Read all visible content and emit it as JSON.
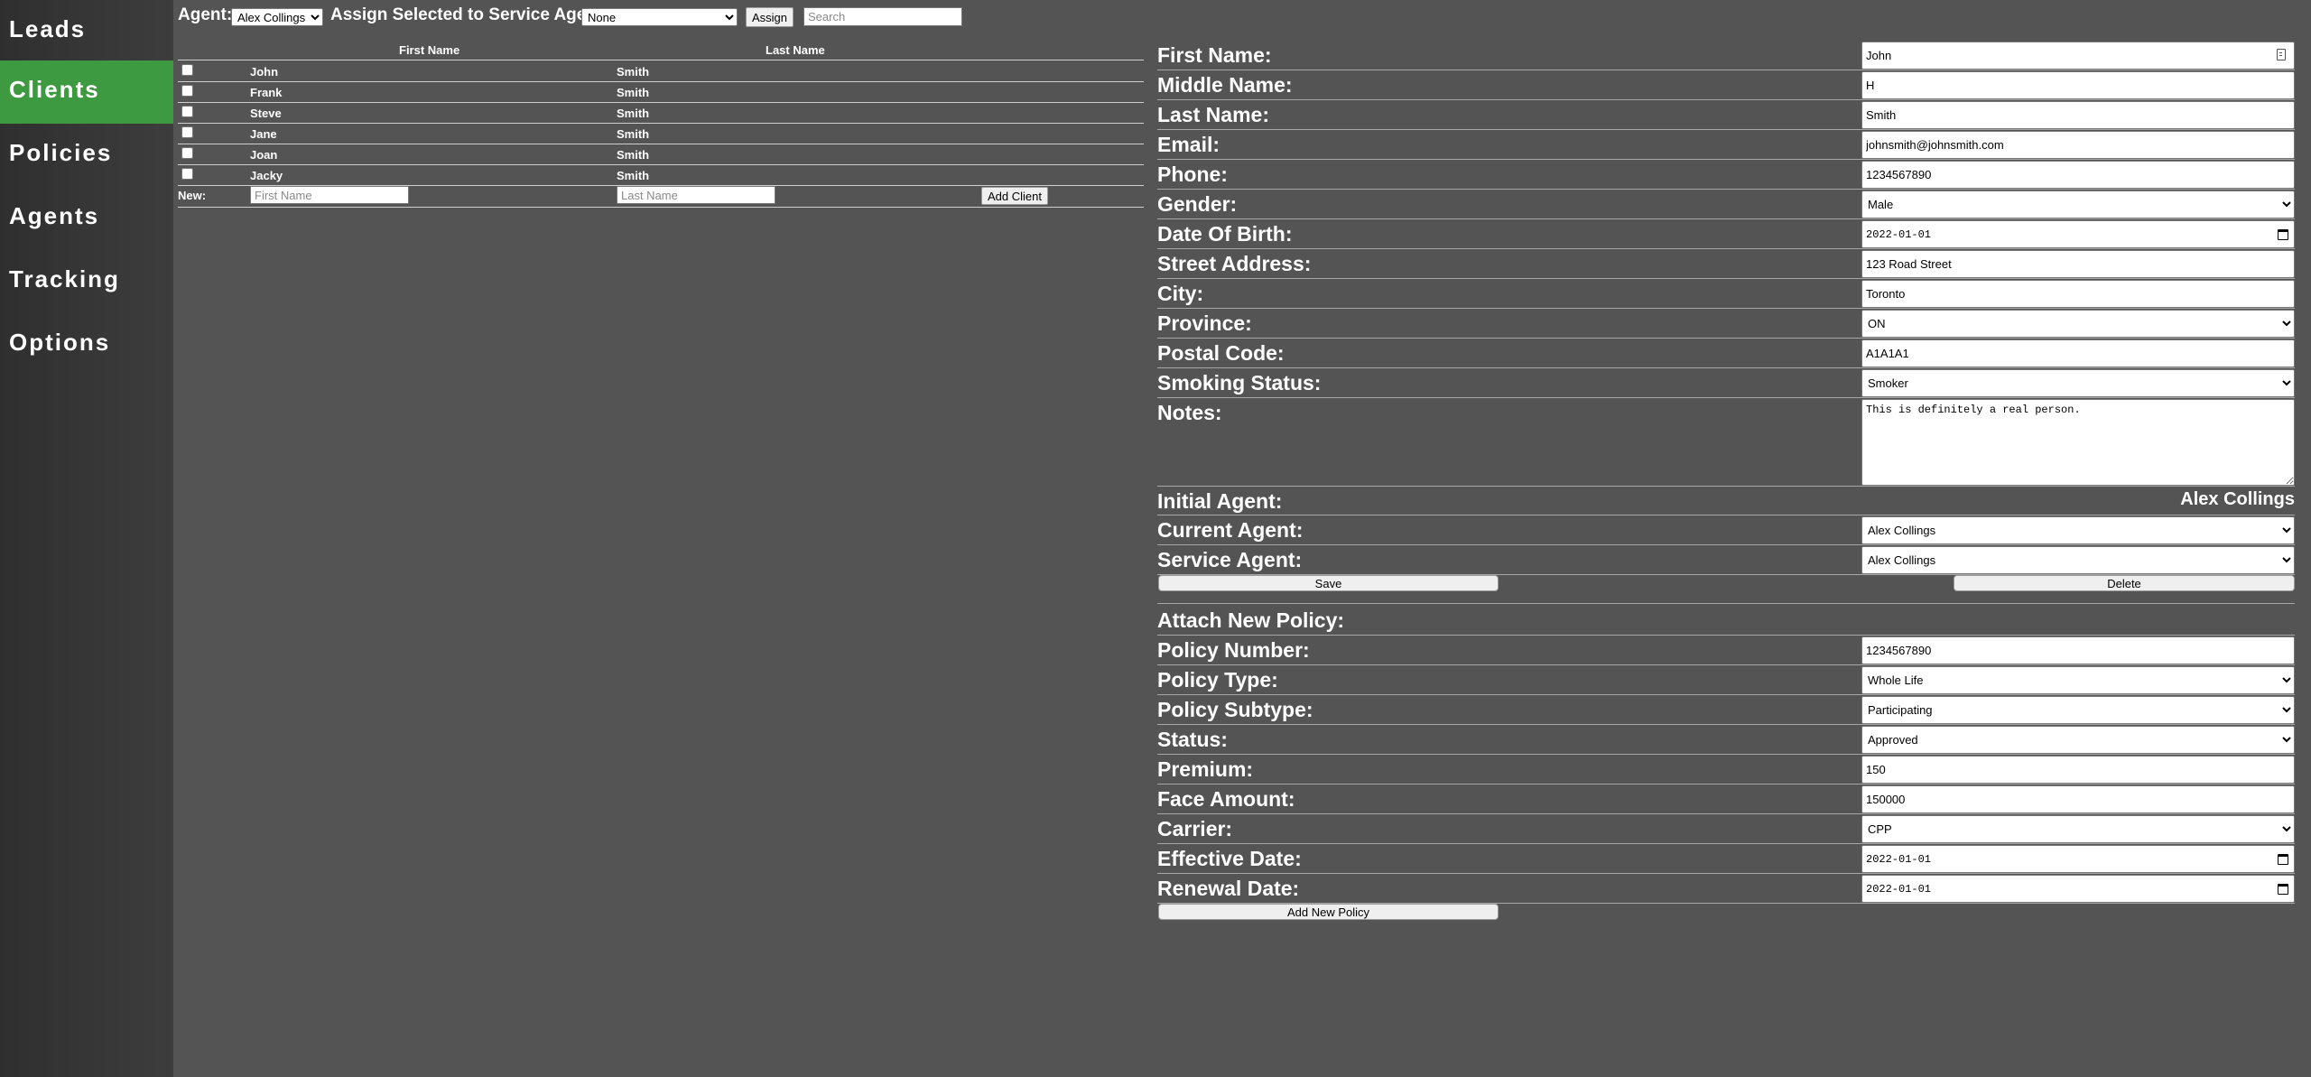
{
  "sidebar": {
    "items": [
      {
        "label": "Leads"
      },
      {
        "label": "Clients"
      },
      {
        "label": "Policies"
      },
      {
        "label": "Agents"
      },
      {
        "label": "Tracking"
      },
      {
        "label": "Options"
      }
    ],
    "active": "Clients",
    "active_color": "#3d9a40"
  },
  "toolbar": {
    "agent_label": "Agent:",
    "agent_selected": "Alex Collings",
    "assign_label": "Assign Selected to Service Agent:",
    "service_agent_selected": "None",
    "assign_button": "Assign",
    "search_placeholder": "Search"
  },
  "clients_table": {
    "headers": {
      "first_name": "First Name",
      "last_name": "Last Name"
    },
    "rows": [
      {
        "first_name": "John",
        "last_name": "Smith"
      },
      {
        "first_name": "Frank",
        "last_name": "Smith"
      },
      {
        "first_name": "Steve",
        "last_name": "Smith"
      },
      {
        "first_name": "Jane",
        "last_name": "Smith"
      },
      {
        "first_name": "Joan",
        "last_name": "Smith"
      },
      {
        "first_name": "Jacky",
        "last_name": "Smith"
      }
    ],
    "new_row": {
      "label": "New:",
      "first_name_placeholder": "First Name",
      "last_name_placeholder": "Last Name",
      "add_button": "Add Client"
    }
  },
  "client_form": {
    "first_name": {
      "label": "First Name:",
      "value": "John"
    },
    "middle_name": {
      "label": "Middle Name:",
      "value": "H"
    },
    "last_name": {
      "label": "Last Name:",
      "value": "Smith"
    },
    "email": {
      "label": "Email:",
      "value": "johnsmith@johnsmith.com"
    },
    "phone": {
      "label": "Phone:",
      "value": "1234567890"
    },
    "gender": {
      "label": "Gender:",
      "value": "Male"
    },
    "date_of_birth": {
      "label": "Date Of Birth:",
      "value": "2022-01-01"
    },
    "street_address": {
      "label": "Street Address:",
      "value": "123 Road Street"
    },
    "city": {
      "label": "City:",
      "value": "Toronto"
    },
    "province": {
      "label": "Province:",
      "value": "ON"
    },
    "postal_code": {
      "label": "Postal Code:",
      "value": "A1A1A1"
    },
    "smoking_status": {
      "label": "Smoking Status:",
      "value": "Smoker"
    },
    "notes": {
      "label": "Notes:",
      "value": "This is definitely a real person."
    },
    "initial_agent": {
      "label": "Initial Agent:",
      "value": "Alex Collings"
    },
    "current_agent": {
      "label": "Current Agent:",
      "value": "Alex Collings"
    },
    "service_agent": {
      "label": "Service Agent:",
      "value": "Alex Collings"
    },
    "save_button": "Save",
    "delete_button": "Delete"
  },
  "policy_form": {
    "section_title": "Attach New Policy:",
    "policy_number": {
      "label": "Policy Number:",
      "value": "1234567890"
    },
    "policy_type": {
      "label": "Policy Type:",
      "value": "Whole Life"
    },
    "policy_subtype": {
      "label": "Policy Subtype:",
      "value": "Participating"
    },
    "status": {
      "label": "Status:",
      "value": "Approved"
    },
    "premium": {
      "label": "Premium:",
      "value": "150"
    },
    "face_amount": {
      "label": "Face Amount:",
      "value": "150000"
    },
    "carrier": {
      "label": "Carrier:",
      "value": "CPP"
    },
    "effective_date": {
      "label": "Effective Date:",
      "value": "2022-01-01"
    },
    "renewal_date": {
      "label": "Renewal Date:",
      "value": "2022-01-01"
    },
    "add_button": "Add New Policy"
  }
}
